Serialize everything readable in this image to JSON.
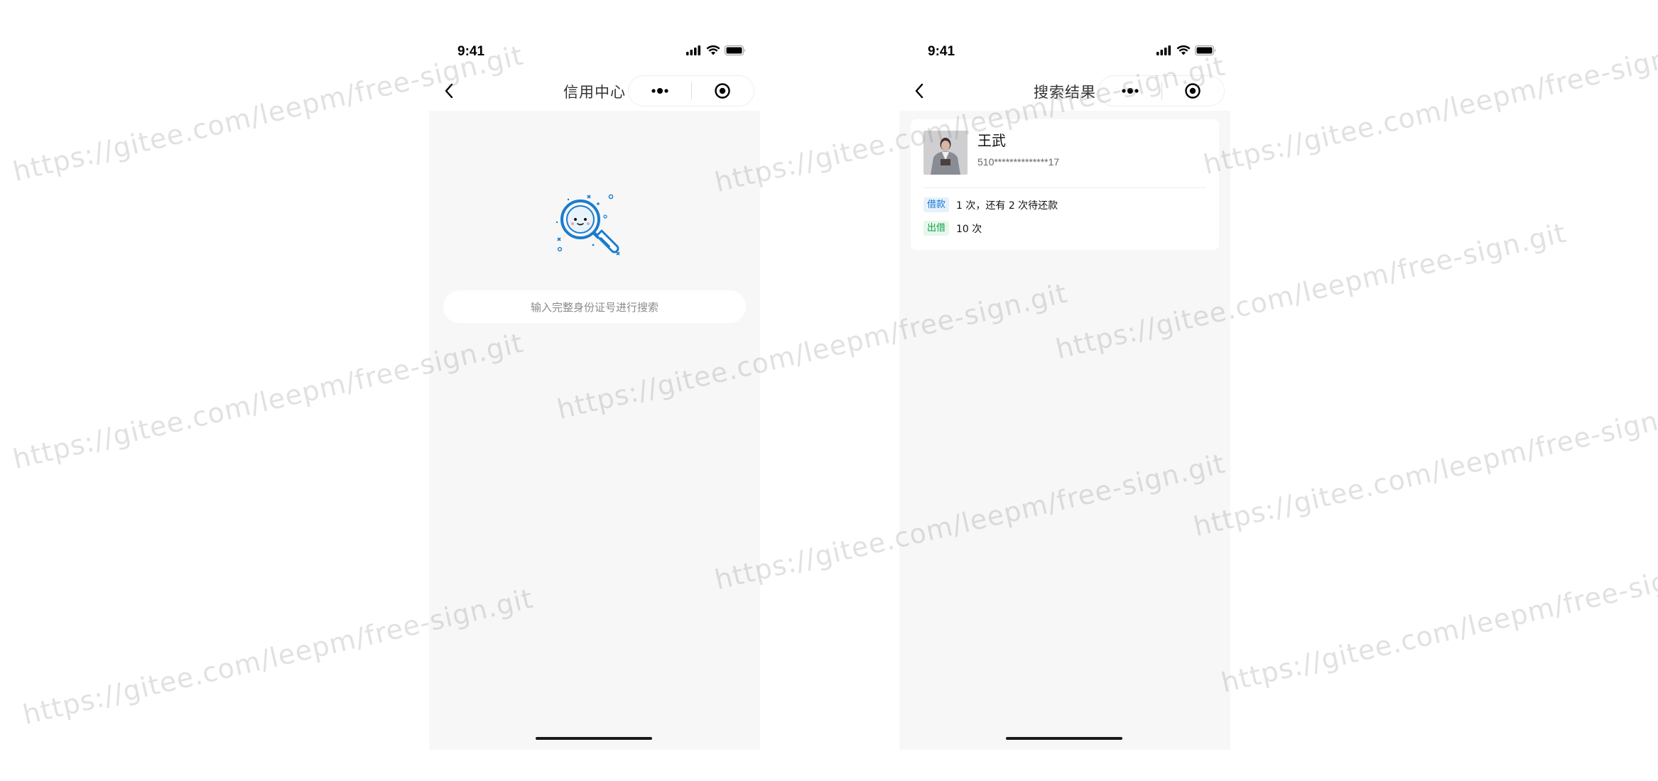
{
  "status_bar": {
    "time": "9:41"
  },
  "screen_left": {
    "nav_title": "信用中心",
    "search": {
      "placeholder": "输入完整身份证号进行搜索"
    },
    "illustration_icon": "magnifier-empty-state-icon"
  },
  "screen_right": {
    "nav_title": "搜索结果",
    "result": {
      "name": "王武",
      "id_number": "510**************17",
      "rows": [
        {
          "tag": "借款",
          "tag_color": "#1677d6",
          "text": "1 次，还有 2 次待还款"
        },
        {
          "tag": "出借",
          "tag_color": "#13a14a",
          "text": "10 次"
        }
      ]
    }
  },
  "colors": {
    "accent_blue": "#1a7ccc",
    "page_bg": "#f7f7f7",
    "card_bg": "#ffffff"
  },
  "watermark": {
    "text": "https://gitee.com/leepm/free-sign.git"
  }
}
